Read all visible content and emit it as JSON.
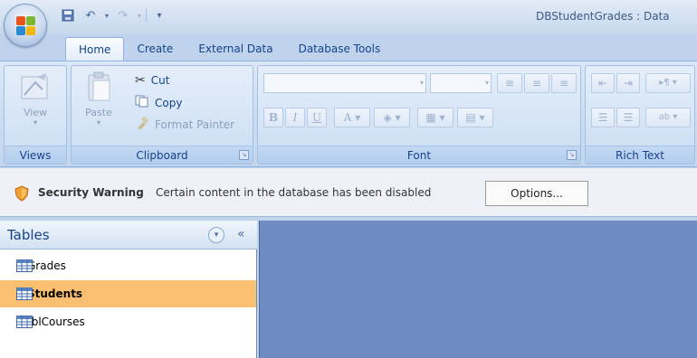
{
  "window": {
    "title": "DBStudentGrades : Data"
  },
  "tabs": [
    {
      "label": "Home"
    },
    {
      "label": "Create"
    },
    {
      "label": "External Data"
    },
    {
      "label": "Database Tools"
    }
  ],
  "ribbon": {
    "views": {
      "view_label": "View",
      "group_label": "Views"
    },
    "clipboard": {
      "paste_label": "Paste",
      "cut_label": "Cut",
      "copy_label": "Copy",
      "format_painter_label": "Format Painter",
      "group_label": "Clipboard"
    },
    "font": {
      "group_label": "Font"
    },
    "rich_text": {
      "group_label": "Rich Text"
    }
  },
  "security": {
    "title": "Security Warning",
    "message": "Certain content in the database has been disabled",
    "options_label": "Options..."
  },
  "nav": {
    "title": "Tables",
    "items": [
      {
        "label": "Grades"
      },
      {
        "label": "Students"
      },
      {
        "label": "tblCourses"
      }
    ]
  },
  "colors": {
    "selected_row": "#fbbf72",
    "workspace": "#6e8cc0",
    "ribbon_text": "#15428b"
  }
}
